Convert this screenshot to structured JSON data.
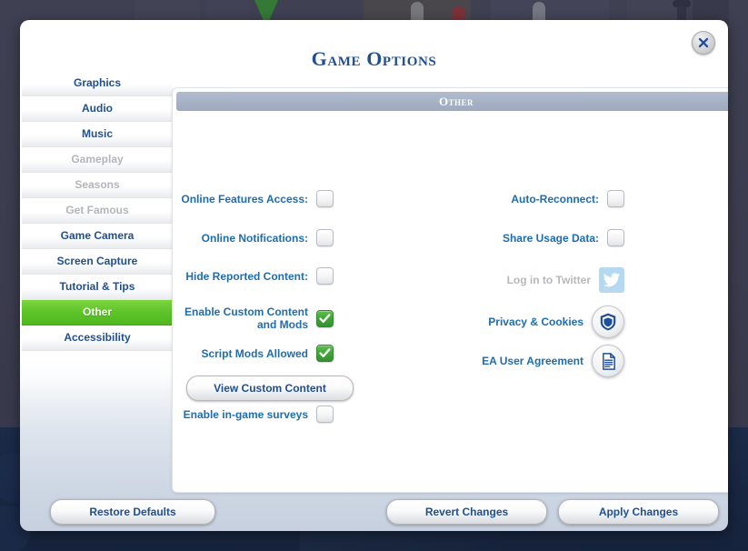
{
  "window": {
    "title": "Game Options",
    "close_icon": "close-icon"
  },
  "sidebar": {
    "items": [
      {
        "label": "Graphics",
        "state": "enabled"
      },
      {
        "label": "Audio",
        "state": "enabled"
      },
      {
        "label": "Music",
        "state": "enabled"
      },
      {
        "label": "Gameplay",
        "state": "disabled"
      },
      {
        "label": "Seasons",
        "state": "disabled"
      },
      {
        "label": "Get Famous",
        "state": "disabled"
      },
      {
        "label": "Game Camera",
        "state": "enabled"
      },
      {
        "label": "Screen Capture",
        "state": "enabled"
      },
      {
        "label": "Tutorial & Tips",
        "state": "enabled"
      },
      {
        "label": "Other",
        "state": "selected"
      },
      {
        "label": "Accessibility",
        "state": "enabled"
      }
    ]
  },
  "panel": {
    "header": "Other",
    "left_column": [
      {
        "label": "Online Features Access:",
        "checked": false,
        "control": "checkbox"
      },
      {
        "label": "Online Notifications:",
        "checked": false,
        "control": "checkbox"
      },
      {
        "label": "Hide Reported Content:",
        "checked": false,
        "control": "checkbox"
      },
      {
        "label": "Enable Custom Content and Mods",
        "checked": true,
        "control": "checkbox"
      },
      {
        "label": "Script Mods Allowed",
        "checked": true,
        "control": "checkbox"
      },
      {
        "label": "Enable in-game surveys",
        "checked": false,
        "control": "checkbox"
      }
    ],
    "view_custom_content_button": "View Custom Content",
    "right_column": [
      {
        "label": "Auto-Reconnect:",
        "checked": false,
        "control": "checkbox"
      },
      {
        "label": "Share Usage Data:",
        "checked": false,
        "control": "checkbox"
      },
      {
        "label": "Log in to Twitter",
        "control": "twitter-icon-button",
        "state": "disabled"
      },
      {
        "label": "Privacy & Cookies",
        "control": "shield-icon-button",
        "state": "enabled"
      },
      {
        "label": "EA User Agreement",
        "control": "document-icon-button",
        "state": "enabled"
      }
    ]
  },
  "footer": {
    "restore_defaults": "Restore Defaults",
    "revert_changes": "Revert Changes",
    "apply_changes": "Apply Changes"
  },
  "colors": {
    "accent_blue": "#1f4f93",
    "label_blue": "#1f6cb0",
    "selected_green": "#5ec42a",
    "checkbox_green": "#41a539",
    "header_slate": "#a4b0c4",
    "disabled_gray": "#b3b5b8"
  }
}
